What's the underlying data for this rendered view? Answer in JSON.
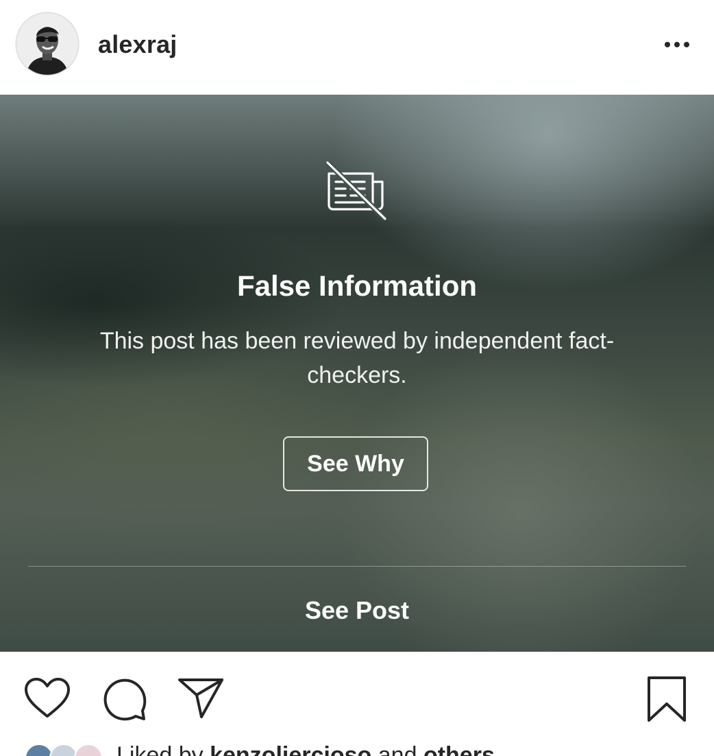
{
  "header": {
    "username": "alexraj"
  },
  "overlay": {
    "title": "False Information",
    "description": "This post has been reviewed by independent fact-checkers.",
    "see_why_label": "See Why",
    "see_post_label": "See Post"
  },
  "liked_by": {
    "prefix": "Liked by",
    "name": "kenzoliercioso",
    "connector": "and",
    "others": "others"
  },
  "icons": {
    "more": "more-options-icon",
    "overlay": "news-crossed-out-icon",
    "like": "heart-icon",
    "comment": "comment-bubble-icon",
    "share": "paper-plane-icon",
    "save": "bookmark-icon"
  },
  "colors": {
    "text": "#262626",
    "overlay_text": "#ffffff",
    "avatar_ring": "#dbdbdb"
  }
}
